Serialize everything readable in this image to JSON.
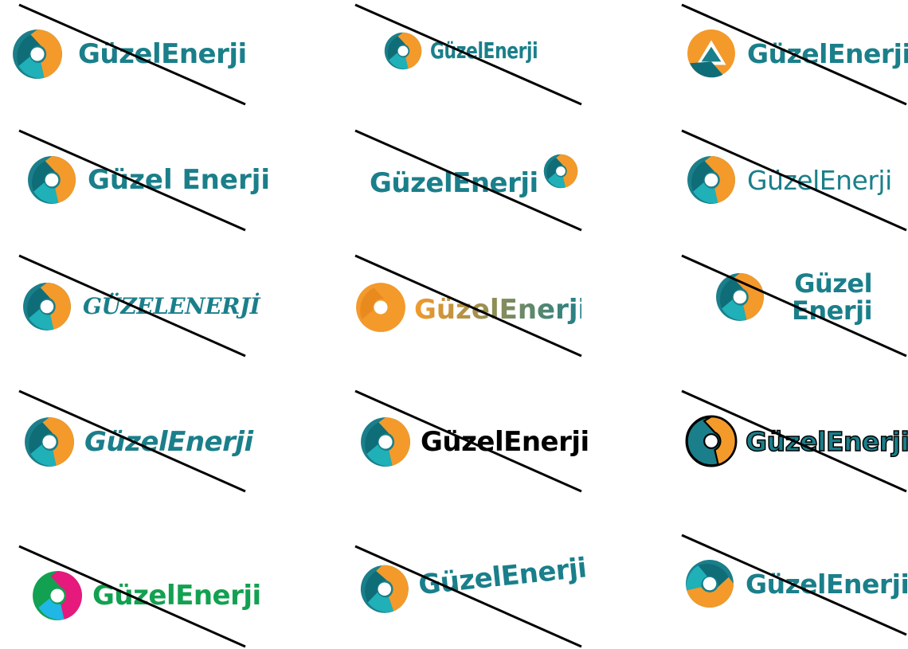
{
  "brand": {
    "wordmark": "GüzelEnerji",
    "wordmark_spaced": "Güzel Enerji",
    "wordmark_upper": "GÜZELENERJİ",
    "line1": "Güzel",
    "line2": "Enerji"
  },
  "colors": {
    "teal": "#1a7f8a",
    "teal_dark": "#0f6d78",
    "orange": "#f39a2b",
    "black": "#000000",
    "green": "#12a150",
    "magenta": "#e6197d",
    "cyan": "#1fb7e6"
  },
  "variants": [
    {
      "id": 1,
      "style": "standard"
    },
    {
      "id": 2,
      "style": "condensed"
    },
    {
      "id": 3,
      "style": "geometric-mark"
    },
    {
      "id": 4,
      "style": "spaced"
    },
    {
      "id": 5,
      "style": "mark-superscript"
    },
    {
      "id": 6,
      "style": "two-weight"
    },
    {
      "id": 7,
      "style": "handwritten-caps"
    },
    {
      "id": 8,
      "style": "gradient"
    },
    {
      "id": 9,
      "style": "stacked"
    },
    {
      "id": 10,
      "style": "italic"
    },
    {
      "id": 11,
      "style": "black-text"
    },
    {
      "id": 12,
      "style": "outlined"
    },
    {
      "id": 13,
      "style": "multicolor"
    },
    {
      "id": 14,
      "style": "tilted"
    },
    {
      "id": 15,
      "style": "mark-rotated"
    }
  ]
}
